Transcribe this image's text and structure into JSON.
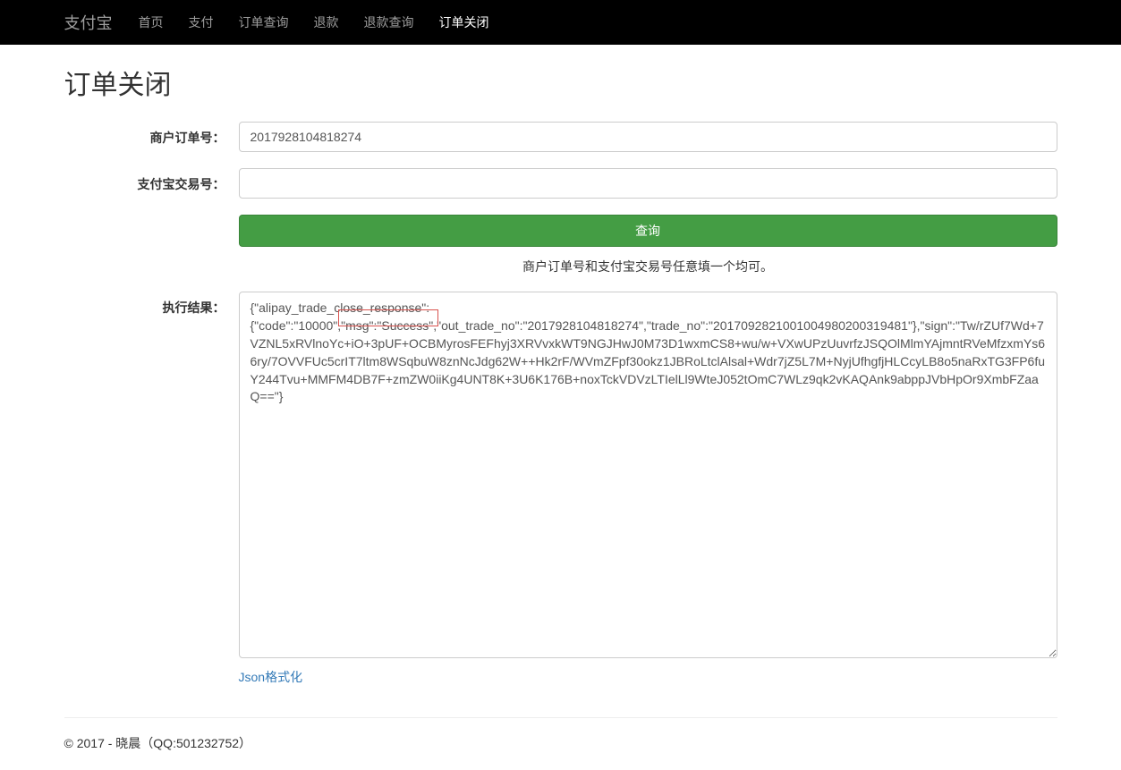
{
  "navbar": {
    "brand": "支付宝",
    "items": [
      {
        "label": "首页"
      },
      {
        "label": "支付"
      },
      {
        "label": "订单查询"
      },
      {
        "label": "退款"
      },
      {
        "label": "退款查询"
      },
      {
        "label": "订单关闭"
      }
    ]
  },
  "page": {
    "title": "订单关闭"
  },
  "form": {
    "merchant_order_label": "商户订单号：",
    "merchant_order_value": "2017928104818274",
    "alipay_trade_label": "支付宝交易号：",
    "alipay_trade_value": "",
    "submit_label": "查询",
    "help_text": "商户订单号和支付宝交易号任意填一个均可。",
    "result_label": "执行结果：",
    "result_value": "{\"alipay_trade_close_response\":{\"code\":\"10000\",\"msg\":\"Success\",\"out_trade_no\":\"2017928104818274\",\"trade_no\":\"2017092821001004980200319481\"},\"sign\":\"Tw/rZUf7Wd+7VZNL5xRVlnoYc+iO+3pUF+OCBMyrosFEFhyj3XRVvxkWT9NGJHwJ0M73D1wxmCS8+wu/w+VXwUPzUuvrfzJSQOlMlmYAjmntRVeMfzxmYs66ry/7OVVFUc5crIT7ltm8WSqbuW8znNcJdg62W++Hk2rF/WVmZFpf30okz1JBRoLtclAlsal+Wdr7jZ5L7M+NyjUfhgfjHLCcyLB8o5naRxTG3FP6fuY244Tvu+MMFM4DB7F+zmZW0iiKg4UNT8K+3U6K176B+noxTckVDVzLTIelLl9WteJ052tOmC7WLz9qk2vKAQAnk9abppJVbHpOr9XmbFZaaQ==\"}",
    "json_format_link": "Json格式化"
  },
  "footer": {
    "text": "© 2017 - 晓晨（QQ:501232752）"
  },
  "highlight": {
    "text": "\"msg\":\"Success\","
  }
}
